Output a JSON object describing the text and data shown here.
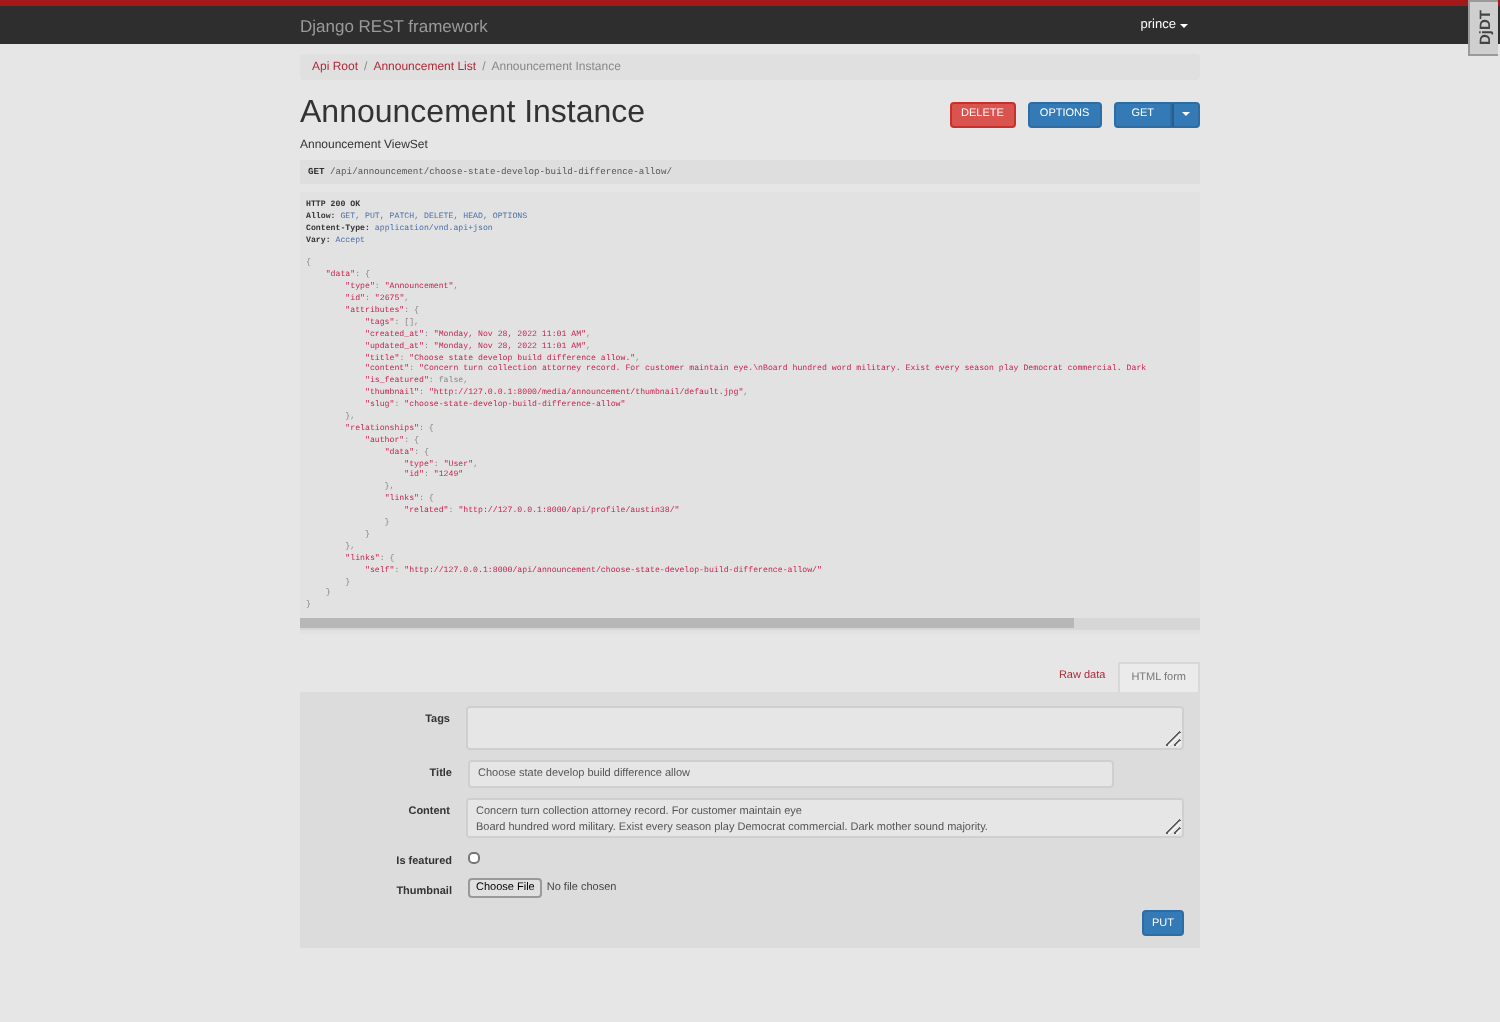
{
  "navbar": {
    "brand": "Django REST framework",
    "user": "prince"
  },
  "debug_toolbar": {
    "label": "DjDT"
  },
  "breadcrumb_separator": "/",
  "breadcrumbs": [
    {
      "label": "Api Root",
      "selected": false
    },
    {
      "label": "Announcement List",
      "selected": false
    },
    {
      "label": "Announcement Instance",
      "selected": true
    }
  ],
  "page_title": "Announcement Instance",
  "subtitle": "Announcement ViewSet",
  "buttons": [
    {
      "label": "DELETE",
      "kind": "danger"
    },
    {
      "label": "OPTIONS",
      "kind": "primary"
    },
    {
      "label": "GET",
      "kind": "split"
    }
  ],
  "request": {
    "method": "GET",
    "path": "/api/announcement/choose-state-develop-build-difference-allow/"
  },
  "response": {
    "status": "HTTP 200 OK",
    "headers": [
      {
        "name": "Allow:",
        "value": "GET, PUT, PATCH, DELETE, HEAD, OPTIONS"
      },
      {
        "name": "Content-Type:",
        "value": "application/vnd.api+json"
      },
      {
        "name": "Vary:",
        "value": "Accept"
      }
    ],
    "body": [
      "{",
      "    \"data\": {",
      "        \"type\": \"Announcement\",",
      "        \"id\": \"2675\",",
      "        \"attributes\": {",
      "            \"tags\": [],",
      "            \"created_at\": \"Monday, Nov 28, 2022 11:01 AM\",",
      "            \"updated_at\": \"Monday, Nov 28, 2022 11:01 AM\",",
      "            \"title\": \"Choose state develop build difference allow.\",",
      "            \"content\": \"Concern turn collection attorney record. For customer maintain eye.\\nBoard hundred word military. Exist every season play Democrat commercial. Dark",
      "            \"is_featured\": false,",
      "            \"thumbnail\": \"http://127.0.0.1:8000/media/announcement/thumbnail/default.jpg\",",
      "            \"slug\": \"choose-state-develop-build-difference-allow\"",
      "        },",
      "        \"relationships\": {",
      "            \"author\": {",
      "                \"data\": {",
      "                    \"type\": \"User\",",
      "                    \"id\": \"1249\"",
      "                },",
      "                \"links\": {",
      "                    \"related\": \"http://127.0.0.1:8000/api/profile/austin38/\"",
      "                }",
      "            }",
      "        },",
      "        \"links\": {",
      "            \"self\": \"http://127.0.0.1:8000/api/announcement/choose-state-develop-build-difference-allow/\"",
      "        }",
      "    }",
      "}"
    ]
  },
  "form_tabs": [
    {
      "label": "Raw data",
      "selected": false
    },
    {
      "label": "HTML form",
      "selected": true
    }
  ],
  "form": {
    "fields": [
      {
        "label": "Tags",
        "kind": "textarea"
      },
      {
        "label": "Title",
        "kind": "input",
        "value": "Choose state develop build difference allow"
      },
      {
        "label": "Content",
        "kind": "textarea",
        "value": "Concern turn collection attorney record. For customer maintain eye\nBoard hundred word military. Exist every season play Democrat commercial. Dark mother sound majority."
      },
      {
        "label": "Is featured",
        "kind": "checkbox",
        "checked": false
      },
      {
        "label": "Thumbnail",
        "kind": "file",
        "button": "Choose File",
        "value": "No file chosen"
      }
    ],
    "submit": "PUT"
  }
}
